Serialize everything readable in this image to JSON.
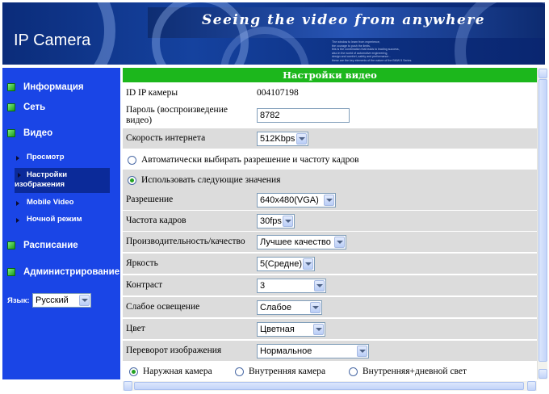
{
  "banner": {
    "slogan": "Seeing the video from anywhere",
    "brand": "IP Camera",
    "fineprint": [
      "The window to learn from experience,",
      "the courage to push the limits,",
      "this is the combination that leads to leading success,",
      "also in the world of automotive engineering,",
      "design and comfort, safety and performance -",
      "these are the key elements of the nature of the BMW 5 Series."
    ]
  },
  "sidebar": {
    "items": [
      {
        "label": "Информация"
      },
      {
        "label": "Сеть"
      },
      {
        "label": "Видео"
      }
    ],
    "video_sub": [
      {
        "label": "Просмотр"
      },
      {
        "label": "Настройки изображения"
      },
      {
        "label": "Mobile Video"
      },
      {
        "label": "Ночной режим"
      }
    ],
    "items2": [
      {
        "label": "Расписание"
      },
      {
        "label": "Администрирование"
      }
    ],
    "language_label": "Язык:",
    "language_value": "Русский"
  },
  "main": {
    "title": "Настройки видео",
    "camera_id_label": "ID IP камеры",
    "camera_id_value": "004107198",
    "password_label": "Пароль (воспроизведение видео)",
    "password_value": "8782",
    "speed_label": "Скорость интернета",
    "speed_value": "512Kbps",
    "auto_option": "Автоматически выбирать разрешение и частоту кадров",
    "manual_option": "Использовать следующие значения",
    "resolution_label": "Разрешение",
    "resolution_value": "640x480(VGA)",
    "framerate_label": "Частота кадров",
    "framerate_value": "30fps",
    "quality_label": "Производительность/качество",
    "quality_value": "Лучшее качество",
    "brightness_label": "Яркость",
    "brightness_value": "5(Средне)",
    "contrast_label": "Контраст",
    "contrast_value": "3",
    "lowlight_label": "Слабое освещение",
    "lowlight_value": "Слабое",
    "color_label": "Цвет",
    "color_value": "Цветная",
    "flip_label": "Переворот изображения",
    "flip_value": "Нормальное",
    "env_options": [
      "Наружная камера",
      "Внутренняя камера",
      "Внутренняя+дневной свет"
    ]
  },
  "colors": {
    "sidebar_bg": "#1a45e6",
    "title_bar": "#1cb71c",
    "row_grey": "#dcdcdc"
  }
}
